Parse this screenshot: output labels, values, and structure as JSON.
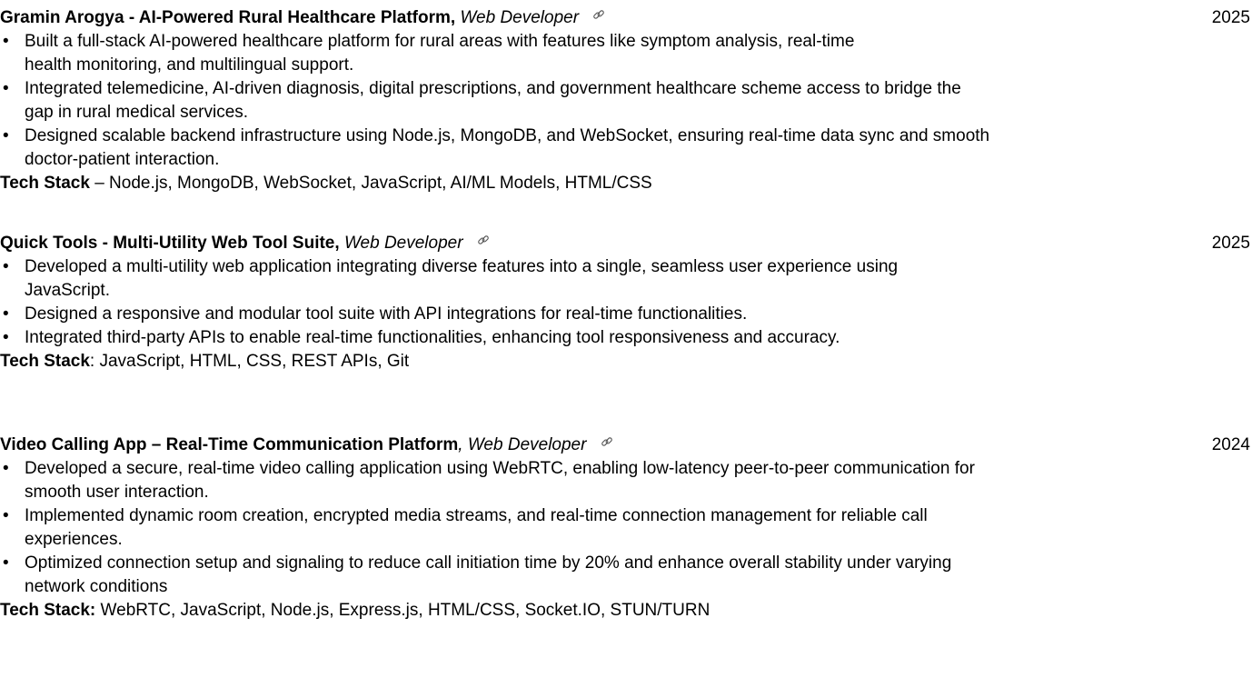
{
  "projects": [
    {
      "title": "Gramin Arogya - AI-Powered Rural Healthcare Platform,",
      "role": "Web Developer",
      "link_icon": "link-icon",
      "year": "2025",
      "bullets": [
        [
          "Built a full-stack AI-powered healthcare platform for rural areas with features like symptom analysis, real-time",
          "health monitoring, and multilingual support."
        ],
        [
          "Integrated telemedicine, AI-driven diagnosis, digital prescriptions, and government healthcare scheme access to bridge the",
          "gap in rural medical services."
        ],
        [
          "Designed scalable backend infrastructure using Node.js, MongoDB, and WebSocket, ensuring real-time data sync and smooth",
          "doctor-patient interaction."
        ]
      ],
      "tech_label": "Tech Stack",
      "tech_sep": " – ",
      "tech_value": "Node.js, MongoDB, WebSocket, JavaScript, AI/ML Models, HTML/CSS"
    },
    {
      "title": "Quick Tools - Multi-Utility Web Tool Suite,",
      "role": "Web Developer",
      "link_icon": "link-icon",
      "year": "2025",
      "bullets": [
        [
          "Developed a multi-utility web application integrating diverse features into a single, seamless user experience using",
          "JavaScript."
        ],
        [
          "Designed a responsive and modular tool suite with API integrations for real-time functionalities."
        ],
        [
          "Integrated third-party APIs to enable real-time functionalities, enhancing tool responsiveness and accuracy."
        ]
      ],
      "tech_label": "Tech Stack",
      "tech_sep": ": ",
      "tech_value": "JavaScript, HTML, CSS, REST APIs, Git"
    },
    {
      "title": "Video Calling App – Real-Time Communication Platform",
      "role": ", Web Developer",
      "link_icon": "link-icon",
      "year": "2024",
      "bullets": [
        [
          "Developed a secure, real-time video calling application using WebRTC, enabling low-latency peer-to-peer communication for",
          "smooth user interaction."
        ],
        [
          "Implemented dynamic room creation, encrypted media streams, and real-time connection management for reliable call",
          "experiences."
        ],
        [
          "Optimized connection setup and signaling to reduce call initiation time by 20% and enhance overall stability under varying",
          "network conditions"
        ]
      ],
      "tech_label": "Tech Stack:",
      "tech_sep": " ",
      "tech_value": "WebRTC, JavaScript, Node.js, Express.js, HTML/CSS, Socket.IO, STUN/TURN"
    }
  ],
  "bullet_glyph": "•"
}
